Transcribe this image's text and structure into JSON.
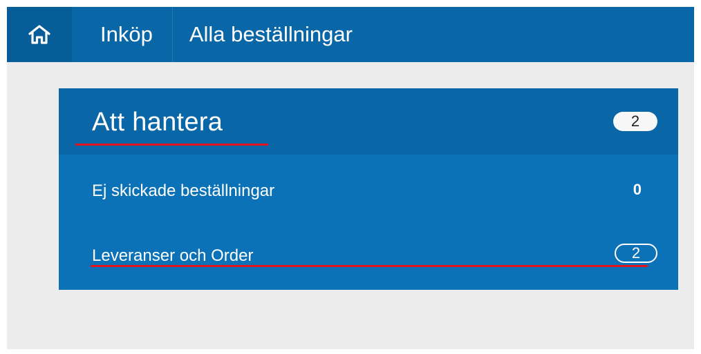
{
  "nav": {
    "home_icon": "home-icon",
    "items": [
      {
        "label": "Inköp"
      },
      {
        "label": "Alla beställningar"
      }
    ]
  },
  "panel": {
    "title": "Att hantera",
    "total_count": "2",
    "rows": [
      {
        "label": "Ej skickade beställningar",
        "count": "0"
      },
      {
        "label": "Leveranser och Order",
        "count": "2"
      }
    ]
  },
  "colors": {
    "nav_bg": "#0a67a7",
    "panel_bg": "#0c72b7",
    "underline": "#e3141d",
    "page_bg": "#ececec"
  }
}
